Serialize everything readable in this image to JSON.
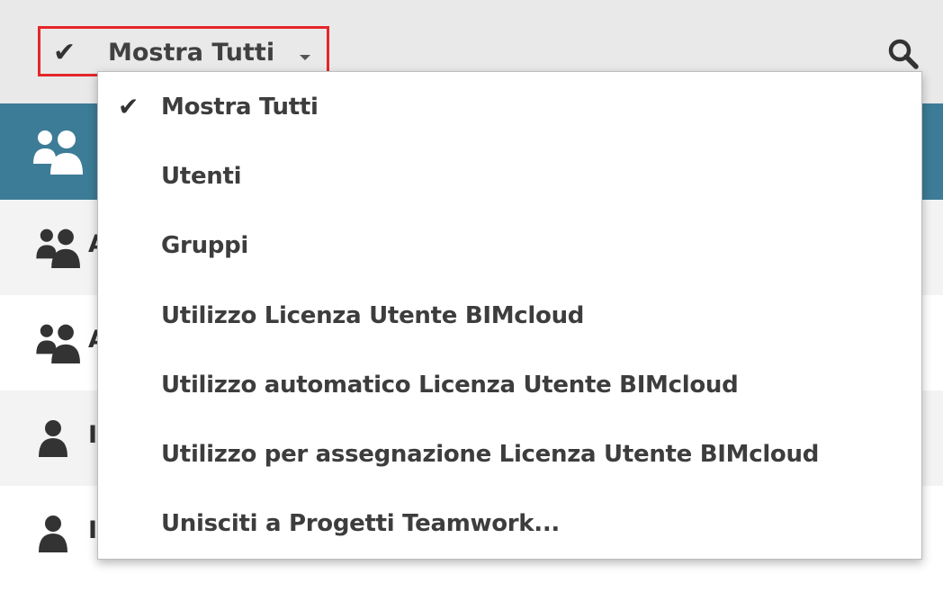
{
  "toolbar": {
    "filter_label": "Mostra Tutti",
    "filter_check": "✔",
    "search_icon": "search-icon"
  },
  "colors": {
    "toolbar_bg": "#e9e9e9",
    "header_band": "#3d7c97",
    "highlight_border": "#e5262a"
  },
  "dropdown": {
    "items": [
      {
        "label": "Mostra Tutti",
        "checked": true,
        "check": "✔"
      },
      {
        "label": "Utenti",
        "checked": false
      },
      {
        "label": "Gruppi",
        "checked": false
      },
      {
        "label": "Utilizzo Licenza Utente BIMcloud",
        "checked": false
      },
      {
        "label": "Utilizzo automatico Licenza Utente BIMcloud",
        "checked": false
      },
      {
        "label": "Utilizzo per assegnazione Licenza Utente BIMcloud",
        "checked": false
      },
      {
        "label": "Unisciti a Progetti Teamwork...",
        "checked": false
      }
    ]
  },
  "list": {
    "rows": [
      {
        "icon": "group-icon",
        "text": "A"
      },
      {
        "icon": "group-icon",
        "text": "A"
      },
      {
        "icon": "user-icon",
        "text": "I"
      },
      {
        "icon": "user-icon",
        "text": "I"
      }
    ]
  }
}
